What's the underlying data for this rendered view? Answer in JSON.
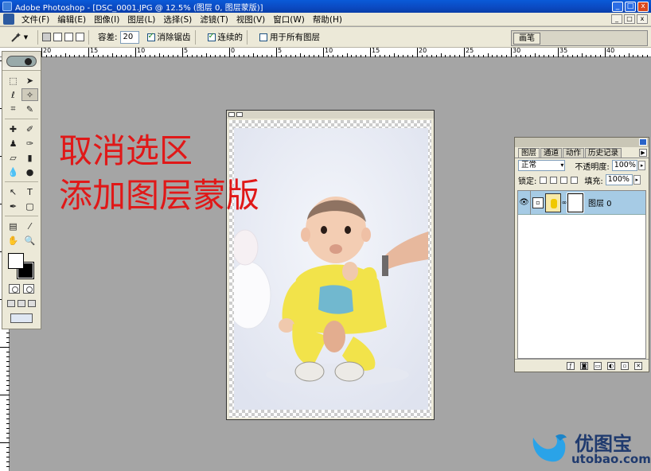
{
  "window": {
    "title": "Adobe Photoshop - [DSC_0001.JPG @ 12.5% (图层 0, 图层蒙版)]",
    "controls": [
      "_",
      "□",
      "x"
    ]
  },
  "menubar": {
    "items": [
      "文件(F)",
      "编辑(E)",
      "图像(I)",
      "图层(L)",
      "选择(S)",
      "滤镜(T)",
      "视图(V)",
      "窗口(W)",
      "帮助(H)"
    ],
    "mdi_controls": [
      "_",
      "□",
      "x"
    ]
  },
  "options": {
    "tolerance_label": "容差:",
    "tolerance_value": "20",
    "antialias_label": "消除锯齿",
    "antialias_checked": true,
    "contiguous_label": "连续的",
    "contiguous_checked": true,
    "all_layers_label": "用于所有图层",
    "all_layers_checked": false,
    "palette_well_tab": "画笔"
  },
  "ruler": {
    "top_labels": [
      "20",
      "15",
      "10",
      "5",
      "0",
      "5",
      "10",
      "15",
      "20",
      "25",
      "30",
      "35",
      "40"
    ]
  },
  "caption": {
    "line1": "取消选区",
    "line2": "添加图层蒙版"
  },
  "layers_panel": {
    "tabs": [
      "图层",
      "通道",
      "动作",
      "历史记录"
    ],
    "blend_mode": "正常",
    "opacity_label": "不透明度:",
    "opacity_value": "100%",
    "lock_label": "锁定:",
    "fill_label": "填充:",
    "fill_value": "100%",
    "layers": [
      {
        "name": "图层 0",
        "visible": true,
        "selected": true
      }
    ]
  },
  "watermark": {
    "cn": "优图宝",
    "en": "utobao.com"
  },
  "colors": {
    "caption": "#e01818",
    "titlebar": "#0b49c1",
    "selected_layer": "#a6cbe5",
    "watermark": "#1f3a6e",
    "bird": "#2aa3e8"
  }
}
